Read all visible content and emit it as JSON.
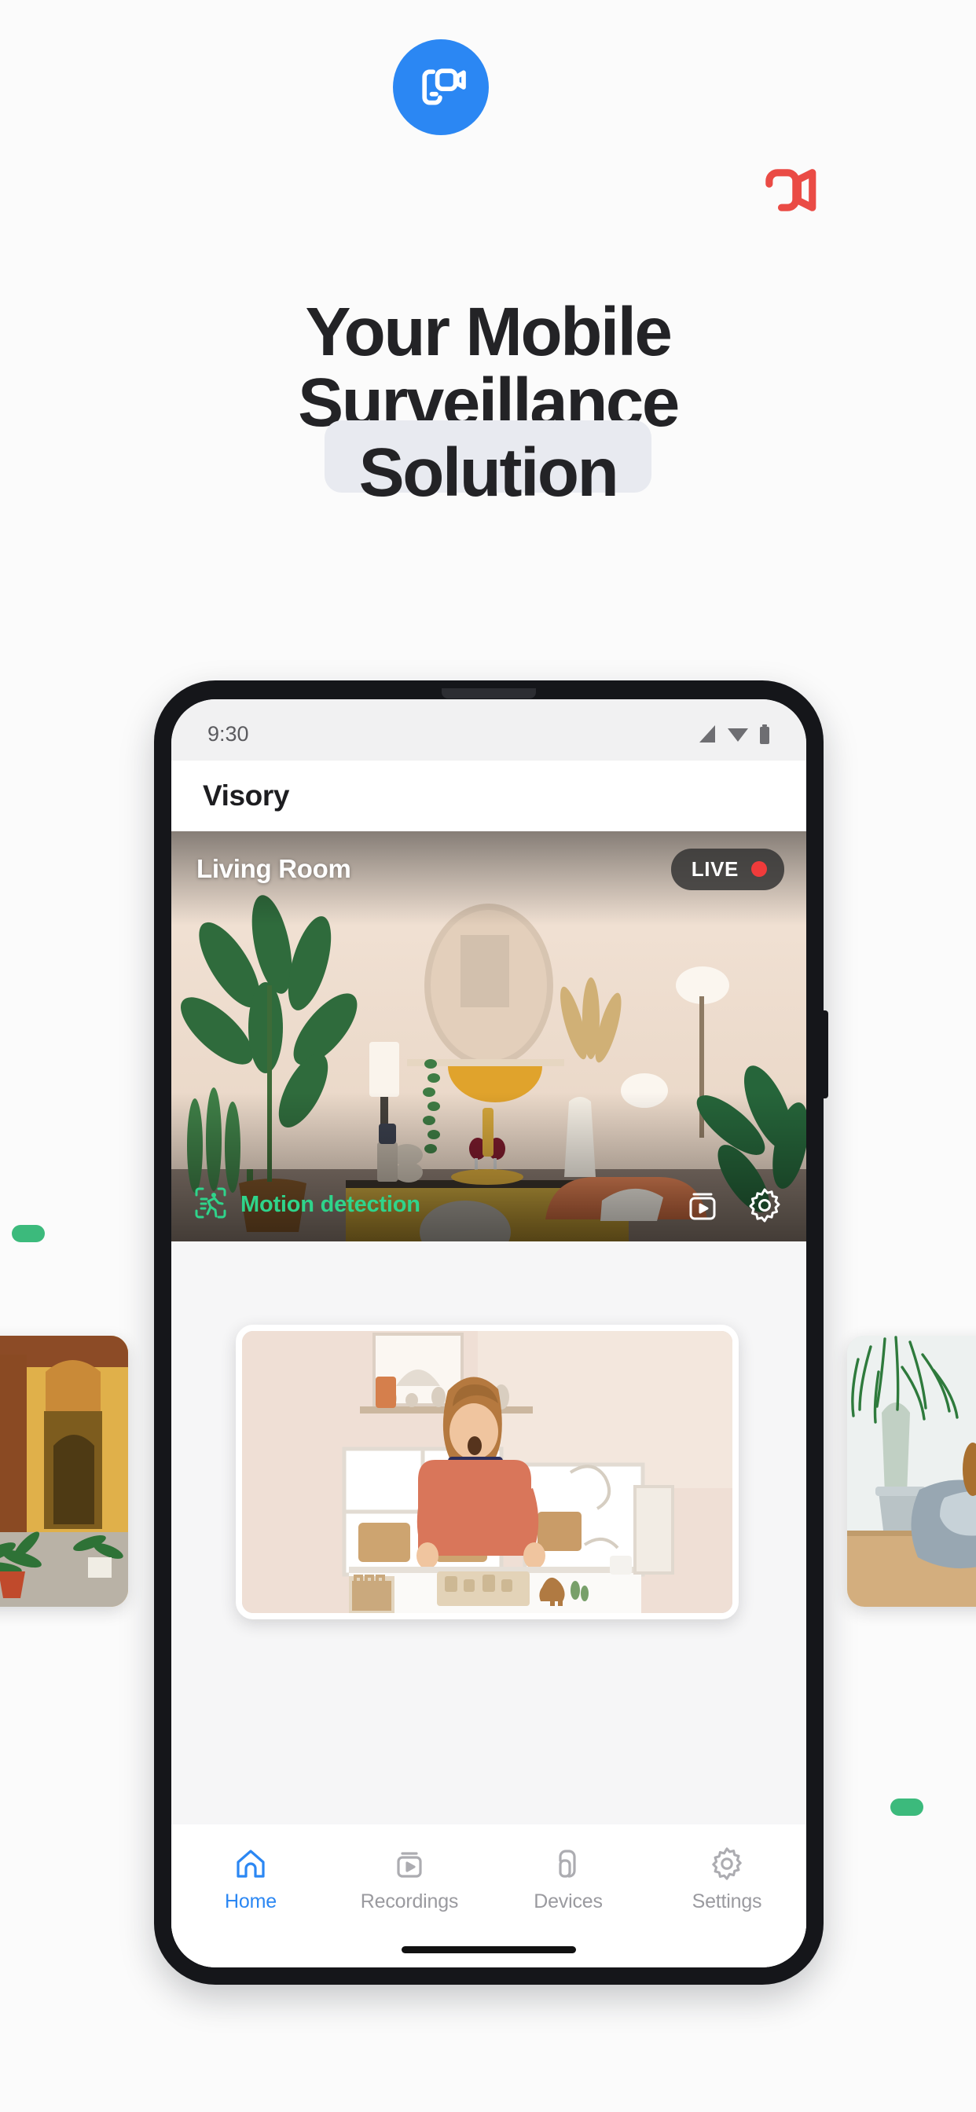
{
  "hero": {
    "logo_icon": "video-camera-chat-logo-icon",
    "logo_color": "#2b87f3",
    "accent_icon": "video-camera-accent-icon",
    "accent_color": "#ea4b45",
    "headline_lines": [
      "Your Mobile",
      "Surveillance",
      "Solution"
    ],
    "highlight_word": "Solution",
    "highlight_bg": "#e8eaf0",
    "text_color": "#232326"
  },
  "decorations": {
    "pill_color": "#3cba7c",
    "pill_left_label": "green-pill-left",
    "pill_right_label": "green-pill-right"
  },
  "phone": {
    "status_bar": {
      "time": "9:30",
      "icons": [
        "signal-icon",
        "wifi-icon",
        "battery-icon"
      ]
    },
    "app_bar": {
      "title": "Visory"
    },
    "feed": {
      "camera_name": "Living Room",
      "live_label": "LIVE",
      "live_dot_color": "#f03b3b",
      "motion_label": "Motion detection",
      "motion_color": "#2fd48b",
      "motion_icon": "motion-detection-icon",
      "actions": [
        "recordings-icon",
        "settings-gear-icon"
      ]
    },
    "carousel": {
      "items": [
        {
          "name": "courtyard-thumbnail",
          "caption": ""
        },
        {
          "name": "playroom-thumbnail",
          "caption": ""
        },
        {
          "name": "dog-beanbag-thumbnail",
          "caption": ""
        }
      ]
    },
    "bottom_nav": {
      "active_color": "#2b87f3",
      "inactive_color": "#9a9a9f",
      "items": [
        {
          "label": "Home",
          "icon": "home-icon",
          "active": true
        },
        {
          "label": "Recordings",
          "icon": "recordings-icon",
          "active": false
        },
        {
          "label": "Devices",
          "icon": "devices-icon",
          "active": false
        },
        {
          "label": "Settings",
          "icon": "settings-gear-icon",
          "active": false
        }
      ]
    }
  }
}
